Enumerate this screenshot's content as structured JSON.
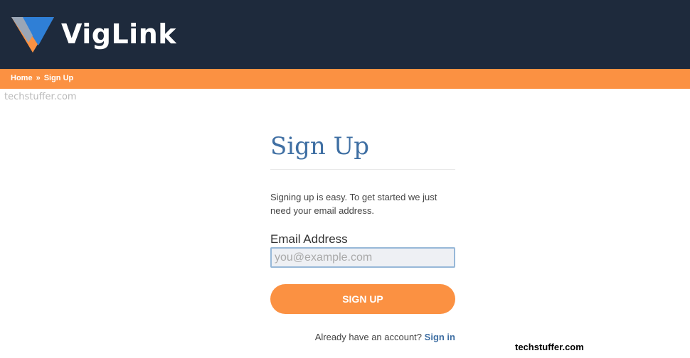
{
  "header": {
    "brand_name": "VigLink",
    "logo_icon": "viglink-logo-icon",
    "colors": {
      "background": "#1e2a3c",
      "accent": "#fb9142",
      "logo_blue": "#2f7fd6"
    }
  },
  "breadcrumb": {
    "home_label": "Home",
    "separator": "»",
    "current_label": "Sign Up"
  },
  "watermarks": {
    "top": "techstuffer.com",
    "bottom": "techstuffer.com"
  },
  "form": {
    "title": "Sign Up",
    "intro": "Signing up is easy. To get started we just need your email address.",
    "email_label": "Email Address",
    "email_placeholder": "you@example.com",
    "email_value": "",
    "submit_label": "SIGN UP",
    "signin_prompt": "Already have an account?",
    "signin_link": "Sign in"
  }
}
